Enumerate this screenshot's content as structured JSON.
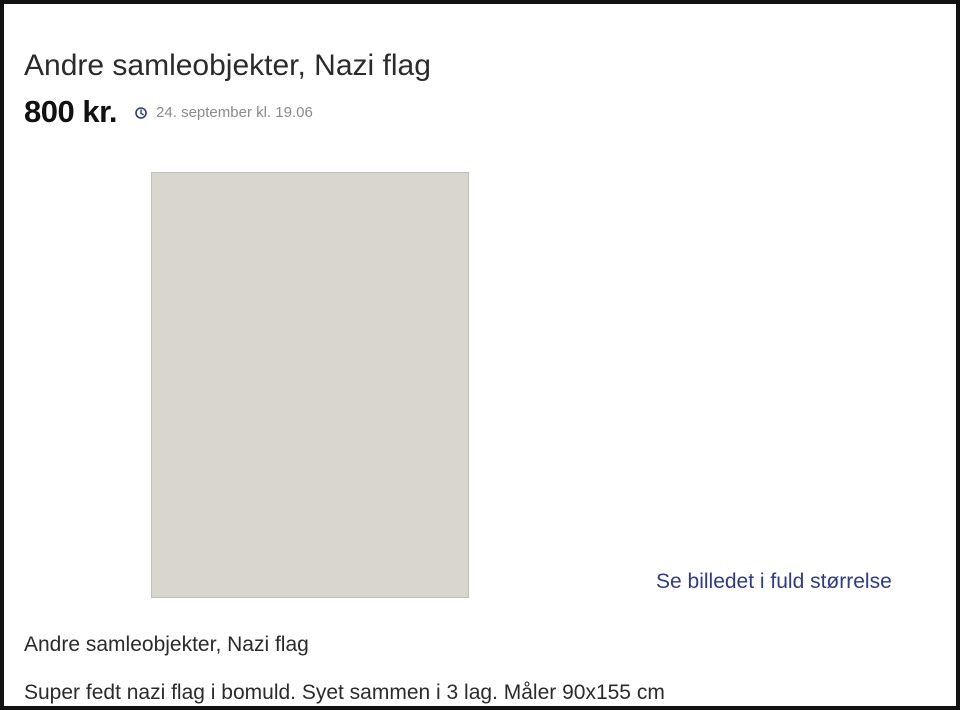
{
  "listing": {
    "title": "Andre samleobjekter, Nazi flag",
    "price": "800 kr.",
    "posted": "24. september kl. 19.06",
    "photo_label": "Nazi flag",
    "fullsize_link": "Se billedet i fuld størrelse",
    "description_title": "Andre samleobjekter, Nazi flag",
    "description": "Super fedt nazi flag i bomuld. Syet sammen i 3 lag. Måler 90x155 cm"
  },
  "icons": {
    "timestamp": "clock-icon"
  },
  "colors": {
    "link": "#2e3a8c",
    "clock_icon": "#2e3a8c",
    "timestamp_text": "#8a8a8a"
  }
}
